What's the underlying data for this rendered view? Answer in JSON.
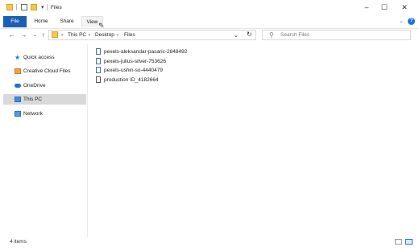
{
  "window": {
    "title": "Files"
  },
  "ribbon": {
    "tabs": [
      "File",
      "Home",
      "Share",
      "View"
    ]
  },
  "address": {
    "crumbs": [
      "This PC",
      "Desktop",
      "Files"
    ],
    "search_placeholder": "Search Files"
  },
  "nav": {
    "items": [
      {
        "label": "Quick access",
        "icon": "star-icon"
      },
      {
        "label": "Creative Cloud Files",
        "icon": "creative-cloud-icon"
      },
      {
        "label": "OneDrive",
        "icon": "cloud-icon"
      },
      {
        "label": "This PC",
        "icon": "computer-icon",
        "selected": true
      },
      {
        "label": "Network",
        "icon": "network-icon"
      }
    ]
  },
  "files": [
    {
      "name": "pexels-aleksandar-pasaric-2848492"
    },
    {
      "name": "pexels-julius-silver-753626"
    },
    {
      "name": "pexels-ushin-so-4440479"
    },
    {
      "name": "production ID_4182664"
    }
  ],
  "status": {
    "item_count": "4 items"
  },
  "colors": {
    "accent": "#1a5fb4",
    "selected": "#d9d9d9"
  }
}
